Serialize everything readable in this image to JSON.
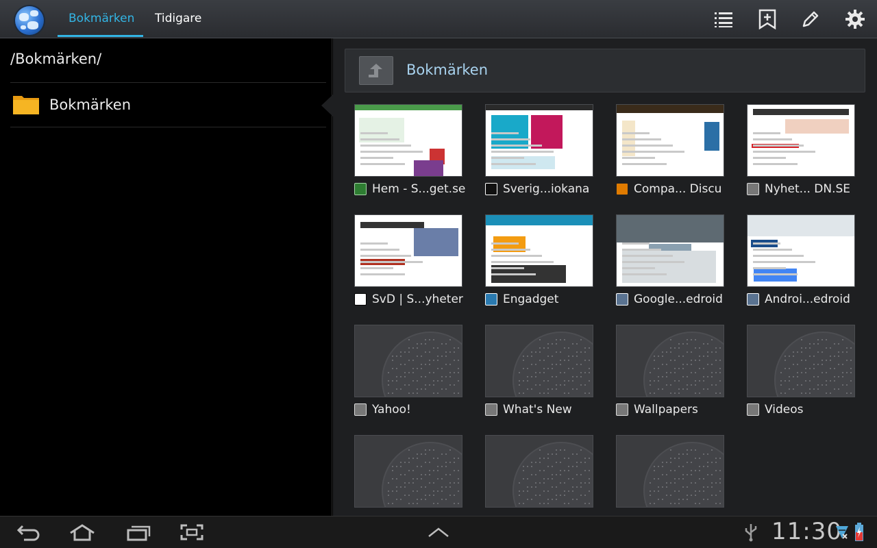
{
  "toolbar": {
    "tabs": [
      {
        "label": "Bokmärken",
        "active": true
      },
      {
        "label": "Tidigare",
        "active": false
      }
    ],
    "actions": [
      "list-icon",
      "add-bookmark-icon",
      "edit-icon",
      "settings-icon"
    ],
    "accent": "#33b5e5"
  },
  "left": {
    "path": "/Bokmärken/",
    "folders": [
      {
        "label": "Bokmärken"
      }
    ]
  },
  "right": {
    "title": "Bokmärken",
    "bookmarks": [
      {
        "label": "Hem - S...get.se"
      },
      {
        "label": "Sverig...iokana"
      },
      {
        "label": "Compa... Discu"
      },
      {
        "label": "Nyhet... DN.SE"
      },
      {
        "label": "SvD | S...yheter"
      },
      {
        "label": "Engadget"
      },
      {
        "label": "Google...edroid"
      },
      {
        "label": "Androi...edroid"
      },
      {
        "label": "Yahoo!"
      },
      {
        "label": "What's New"
      },
      {
        "label": "Wallpapers"
      },
      {
        "label": "Videos"
      },
      {
        "label": ""
      },
      {
        "label": ""
      },
      {
        "label": ""
      }
    ]
  },
  "sysbar": {
    "time": "11:30"
  }
}
